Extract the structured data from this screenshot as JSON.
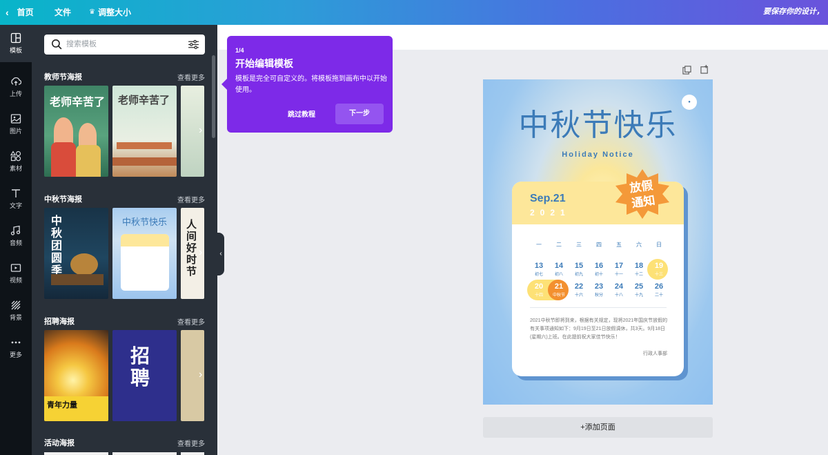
{
  "topbar": {
    "home_label": "首页",
    "file_label": "文件",
    "resize_label": "调整大小",
    "save_note": "要保存你的设计，"
  },
  "rail": [
    {
      "icon": "template-icon",
      "label": "模板"
    },
    {
      "icon": "upload-icon",
      "label": "上传"
    },
    {
      "icon": "image-icon",
      "label": "图片"
    },
    {
      "icon": "elements-icon",
      "label": "素材"
    },
    {
      "icon": "text-icon",
      "label": "文字"
    },
    {
      "icon": "music-icon",
      "label": "音频"
    },
    {
      "icon": "video-icon",
      "label": "视频"
    },
    {
      "icon": "background-icon",
      "label": "背景"
    },
    {
      "icon": "more-icon",
      "label": "更多"
    }
  ],
  "search": {
    "placeholder": "搜索模板"
  },
  "sections": [
    {
      "title": "教师节海报",
      "more": "查看更多",
      "thumbs": [
        "老师辛苦了",
        "老师辛苦了"
      ]
    },
    {
      "title": "中秋节海报",
      "more": "查看更多",
      "thumbs": [
        "中秋团圆季",
        "中秋节快乐",
        "人间好时节"
      ]
    },
    {
      "title": "招聘海报",
      "more": "查看更多",
      "thumbs": [
        "青年力量",
        "招聘"
      ]
    },
    {
      "title": "活动海报",
      "more": "查看更多"
    }
  ],
  "tooltip": {
    "step": "1/4",
    "title": "开始编辑模板",
    "desc": "模板是完全可自定义的。将模板拖到画布中以开始使用。",
    "skip": "跳过教程",
    "next": "下一步"
  },
  "design": {
    "title": "中秋节快乐",
    "subtitle": "Holiday Notice",
    "month": "Sep.21",
    "year": "2021",
    "badge": "放假通知",
    "weekdays": [
      "一",
      "二",
      "三",
      "四",
      "五",
      "六",
      "日"
    ],
    "row1": [
      {
        "d": "13",
        "l": "初七"
      },
      {
        "d": "14",
        "l": "初八"
      },
      {
        "d": "15",
        "l": "初九"
      },
      {
        "d": "16",
        "l": "初十"
      },
      {
        "d": "17",
        "l": "十一"
      },
      {
        "d": "18",
        "l": "十二"
      },
      {
        "d": "19",
        "l": "十三"
      }
    ],
    "row2": [
      {
        "d": "20",
        "l": "十四"
      },
      {
        "d": "21",
        "l": "中秋节"
      },
      {
        "d": "22",
        "l": "十六"
      },
      {
        "d": "23",
        "l": "秋分"
      },
      {
        "d": "24",
        "l": "十八"
      },
      {
        "d": "25",
        "l": "十九"
      },
      {
        "d": "26",
        "l": "二十"
      }
    ],
    "notice": "2021中秋节即将到来，根据有关规定，现将2021年国庆节放假的有关事项通知如下：9月19日至21日放假调休，共3天。9月18日(星期六)上班。在此提前祝大家佳节快乐！",
    "signature": "行政人事部"
  },
  "add_page": "+添加页面",
  "colors": {
    "accent": "#7d2ae8",
    "panel": "#293039",
    "rail": "#0e1318"
  }
}
